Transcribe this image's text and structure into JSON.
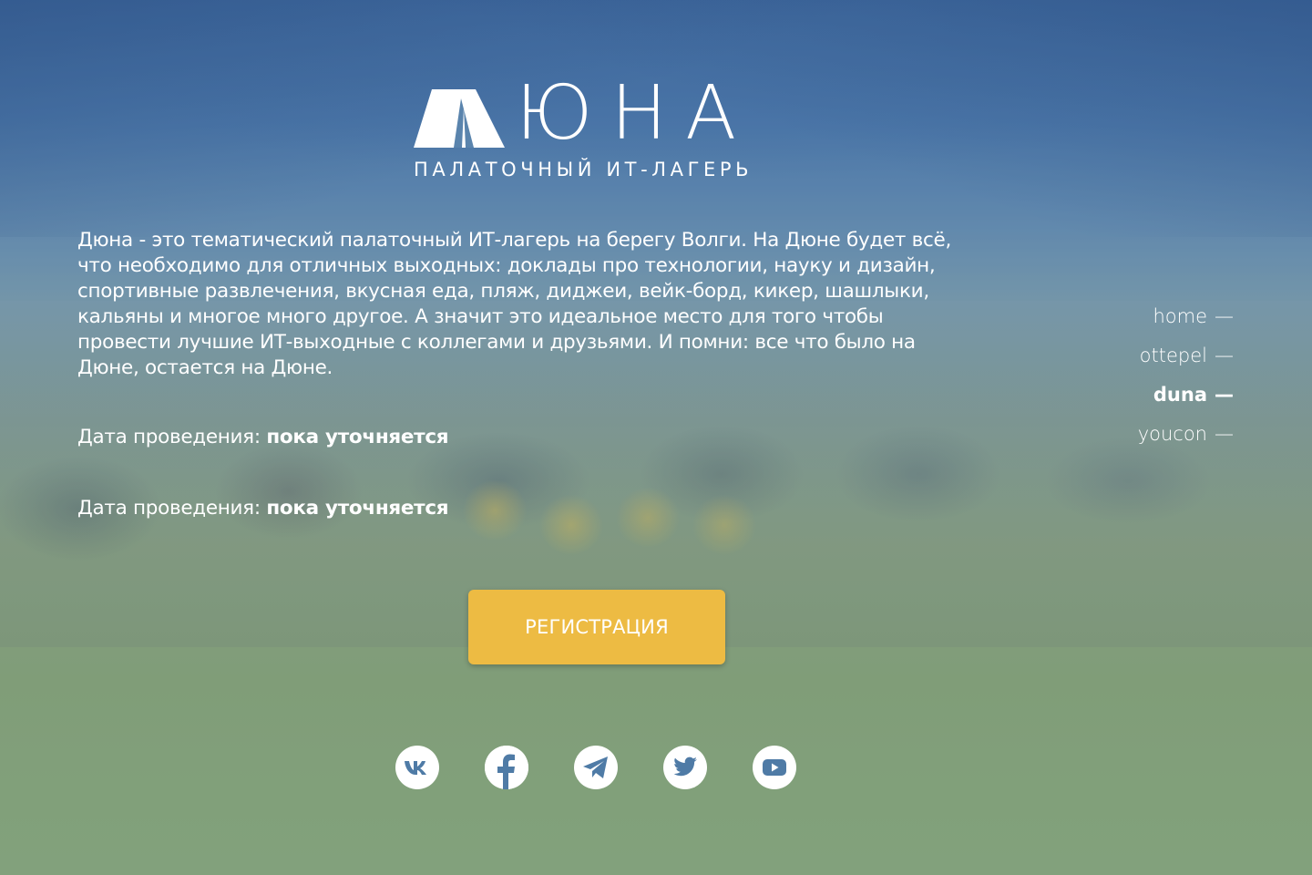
{
  "logo": {
    "word": "ЮНА",
    "subtitle": "ПАЛАТОЧНЫЙ ИТ-ЛАГЕРЬ"
  },
  "description": "Дюна - это тематический палаточный ИТ-лагерь на берегу Волги. На Дюне будет всё, что необходимо для отличных выходных: доклады про технологии, науку и дизайн, спортивные развлечения, вкусная еда, пляж, диджеи, вейк-борд, кикер, шашлыки, кальяны и многое много другое. А значит это идеальное место для того чтобы провести лучшие ИТ-выходные с коллегами и друзьями. И помни: все что было на Дюне, остается на Дюне.",
  "dates": [
    {
      "label": "Дата проведения:",
      "value": "пока уточняется"
    },
    {
      "label": "Дата проведения:",
      "value": "пока уточняется"
    }
  ],
  "nav": {
    "items": [
      {
        "label": "home",
        "dash": "—"
      },
      {
        "label": "ottepel",
        "dash": "—"
      },
      {
        "label": "duna",
        "dash": "—",
        "active": true
      },
      {
        "label": "youcon",
        "dash": "—"
      }
    ]
  },
  "register_button": "РЕГИСТРАЦИЯ",
  "colors": {
    "button": "#edbb43",
    "text": "#ffffff",
    "icon_fill": "#4f7ba6"
  },
  "socials": [
    {
      "icon": "vk-icon"
    },
    {
      "icon": "facebook-icon"
    },
    {
      "icon": "telegram-icon"
    },
    {
      "icon": "twitter-icon"
    },
    {
      "icon": "youtube-icon"
    }
  ]
}
